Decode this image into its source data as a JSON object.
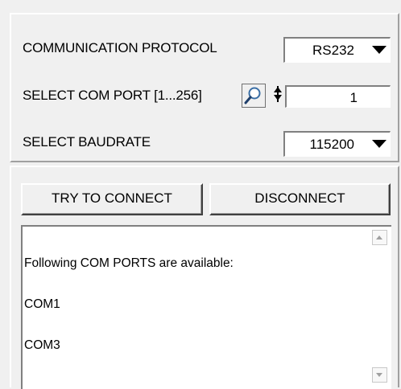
{
  "connection": {
    "protocol_label": "COMMUNICATION PROTOCOL",
    "protocol_value": "RS232",
    "com_port_label": "SELECT COM PORT [1...256]",
    "com_port_value": "1",
    "baudrate_label": "SELECT BAUDRATE",
    "baudrate_value": "115200"
  },
  "buttons": {
    "connect_label": "TRY TO CONNECT",
    "disconnect_label": "DISCONNECT"
  },
  "log": {
    "lines": [
      "Following COM PORTS are available:",
      "COM1",
      "COM3"
    ]
  },
  "icons": {
    "search": "magnifier-icon",
    "spinner": "spinner-icon",
    "dropdown": "triangle-down"
  }
}
